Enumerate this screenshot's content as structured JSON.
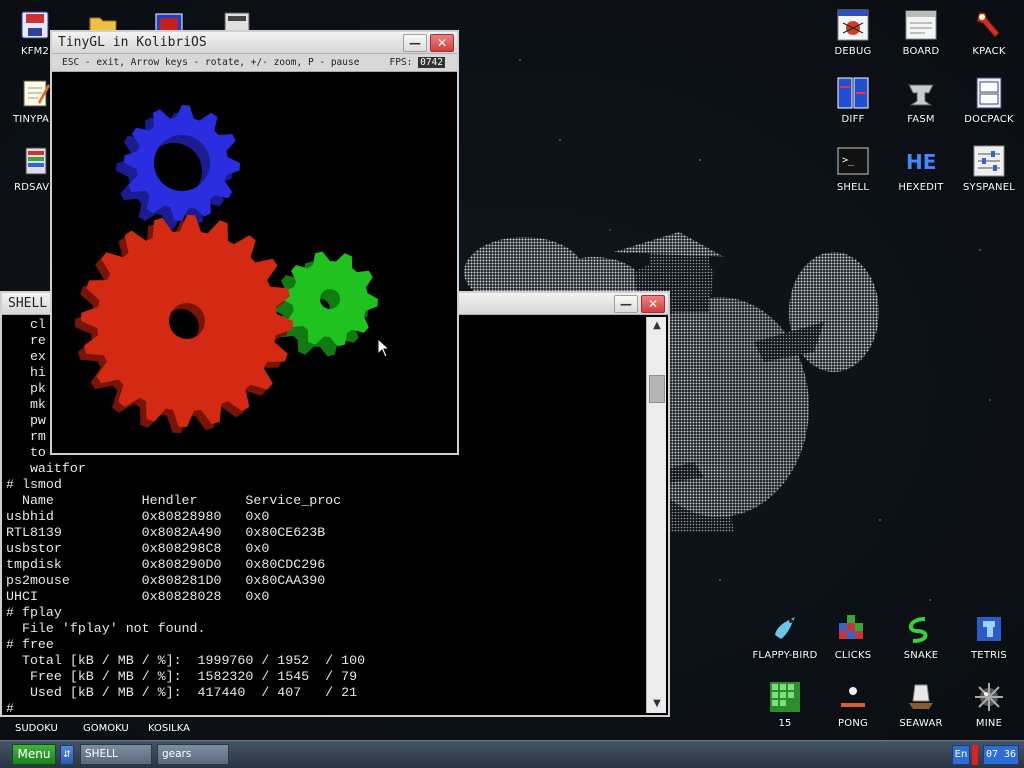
{
  "desktop": {
    "icons_left": [
      {
        "label": "KFM2"
      },
      {
        "label": "TINYPAD"
      },
      {
        "label": "RDSAVE"
      }
    ],
    "icons_right_top": [
      {
        "label": "DEBUG"
      },
      {
        "label": "BOARD"
      },
      {
        "label": "KPACK"
      },
      {
        "label": "DIFF"
      },
      {
        "label": "FASM"
      },
      {
        "label": "DOCPACK"
      },
      {
        "label": "SHELL"
      },
      {
        "label": "HEXEDIT"
      },
      {
        "label": "SYSPANEL"
      }
    ],
    "icons_right_bottom": [
      {
        "label": "FLAPPY-BIRD"
      },
      {
        "label": "CLICKS"
      },
      {
        "label": "SNAKE"
      },
      {
        "label": "TETRIS"
      },
      {
        "label": "15"
      },
      {
        "label": "PONG"
      },
      {
        "label": "SEAWAR"
      },
      {
        "label": "MINE"
      }
    ],
    "icons_bottom_left": [
      {
        "label": "SUDOKU"
      },
      {
        "label": "GOMOKU"
      },
      {
        "label": "KOSILKA"
      }
    ]
  },
  "gears_window": {
    "title": "TinyGL in KolibriOS",
    "help": "ESC - exit, Arrow keys - rotate, +/- zoom, P - pause",
    "fps_label": "FPS:",
    "fps_value": "0742",
    "colors": {
      "red": "#d42a14",
      "green": "#1fc21f",
      "blue": "#2a2ee0"
    }
  },
  "shell_window": {
    "title": "SHELL",
    "lines": [
      "   cl",
      "   re",
      "   ex",
      "   hi",
      "   pk",
      "   mk",
      "   pw",
      "   rm",
      "   to",
      "   waitfor",
      "# lsmod",
      "  Name           Hendler      Service_proc",
      "usbhid           0x80828980   0x0",
      "RTL8139          0x8082A490   0x80CE623B",
      "usbstor          0x808298C8   0x0",
      "tmpdisk          0x808290D0   0x80CDC296",
      "ps2mouse         0x808281D0   0x80CAA390",
      "UHCI             0x80828028   0x0",
      "# fplay",
      "  File 'fplay' not found.",
      "# free",
      "  Total [kB / MB / %]:  1999760 / 1952  / 100",
      "   Free [kB / MB / %]:  1582320 / 1545  / 79",
      "   Used [kB / MB / %]:  417440  / 407   / 21",
      "# "
    ]
  },
  "taskbar": {
    "menu_label": "Menu",
    "tasks": [
      {
        "label": "SHELL"
      },
      {
        "label": "gears"
      }
    ],
    "lang": "En",
    "clock": "07 36"
  }
}
